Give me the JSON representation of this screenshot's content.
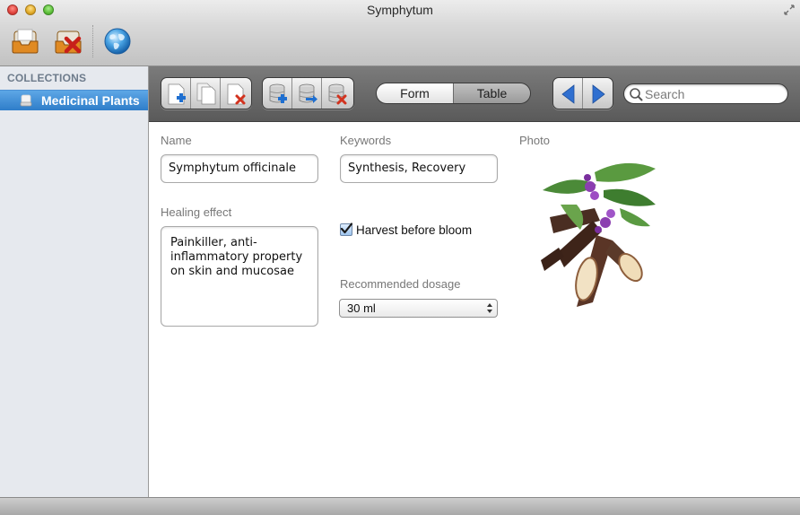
{
  "window": {
    "title": "Symphytum"
  },
  "sidebar": {
    "header": "COLLECTIONS",
    "items": [
      {
        "label": "Medicinal Plants",
        "selected": true
      }
    ]
  },
  "toolbar": {
    "icons": [
      "new-collection-icon",
      "delete-collection-icon",
      "web-globe-icon"
    ],
    "field_buttons": [
      "add-field-icon",
      "duplicate-field-icon",
      "delete-field-icon"
    ],
    "record_buttons": [
      "add-record-icon",
      "import-records-icon",
      "delete-record-icon"
    ],
    "views": [
      "Form",
      "Table"
    ],
    "active_view": "Form",
    "nav": [
      "back-arrow-icon",
      "forward-arrow-icon"
    ],
    "search_placeholder": "Search"
  },
  "form": {
    "name_label": "Name",
    "name_value": "Symphytum officinale",
    "keywords_label": "Keywords",
    "keywords_value": "Synthesis, Recovery",
    "photo_label": "Photo",
    "healing_label": "Healing effect",
    "healing_lines": [
      "Painkiller, anti-",
      "inflammatory property",
      "on skin and mucosae"
    ],
    "harvest_label": "Harvest before bloom",
    "harvest_checked": true,
    "dosage_label": "Recommended dosage",
    "dosage_value": "30 ml"
  },
  "colors": {
    "sidebar_selection": "#2f7dc9",
    "toolbar_dark": "#5a5a5a",
    "nav_arrow_blue": "#2f6fd0"
  }
}
